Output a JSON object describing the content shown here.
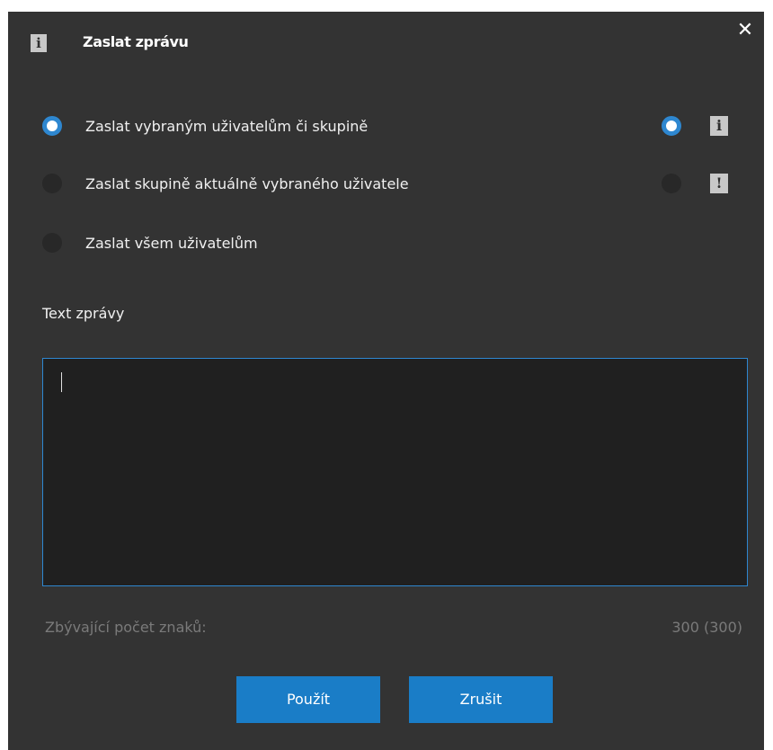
{
  "dialog": {
    "title": "Zaslat zprávu",
    "title_icon": "info-icon",
    "close_glyph": "✕"
  },
  "recipients": [
    {
      "label": "Zaslat vybraným uživatelům či skupině",
      "selected": true
    },
    {
      "label": "Zaslat skupině aktuálně vybraného uživatele",
      "selected": false
    },
    {
      "label": "Zaslat všem uživatelům",
      "selected": false
    }
  ],
  "message_type": [
    {
      "icon": "info-icon",
      "glyph": "i",
      "selected": true
    },
    {
      "icon": "warning-icon",
      "glyph": "!",
      "selected": false
    }
  ],
  "message": {
    "label": "Text zprávy",
    "value": "",
    "remaining_label": "Zbývající počet znaků:",
    "remaining_value": "300 (300)"
  },
  "buttons": {
    "apply": "Použít",
    "cancel": "Zrušit"
  },
  "colors": {
    "background": "#333333",
    "accent": "#1a7dc7",
    "input_border": "#2e87d0"
  }
}
